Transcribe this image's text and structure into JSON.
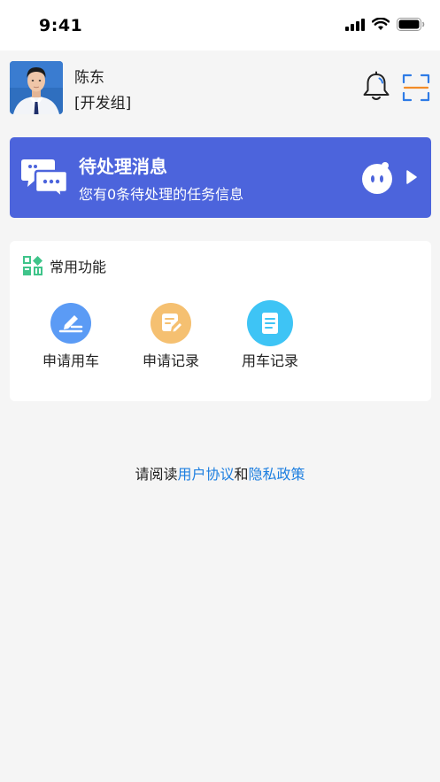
{
  "status_bar": {
    "time": "9:41",
    "icons": [
      "cellular-signal-icon",
      "wifi-icon",
      "battery-icon"
    ]
  },
  "header": {
    "user_name": "陈东",
    "user_group": "[开发组]",
    "bell_icon": "bell-icon",
    "scan_icon": "scan-icon"
  },
  "banner": {
    "title": "待处理消息",
    "subtitle": "您有0条待处理的任务信息",
    "background_color": "#4c64dc",
    "icons": [
      "chat-bubbles-icon",
      "mascot-icon",
      "arrow-right-icon"
    ]
  },
  "functions": {
    "title": "常用功能",
    "title_icon": "grid-apps-icon",
    "items": [
      {
        "label": "申请用车",
        "icon": "edit-icon",
        "color": "#5b9bf5"
      },
      {
        "label": "申请记录",
        "icon": "note-edit-icon",
        "color": "#f5c071"
      },
      {
        "label": "用车记录",
        "icon": "document-icon",
        "color": "#3ec4f5"
      }
    ]
  },
  "agreement": {
    "prefix": "请阅读",
    "user_agreement": "用户协议",
    "conjunction": "和",
    "privacy_policy": "隐私政策",
    "link_color": "#1e7fe0"
  }
}
